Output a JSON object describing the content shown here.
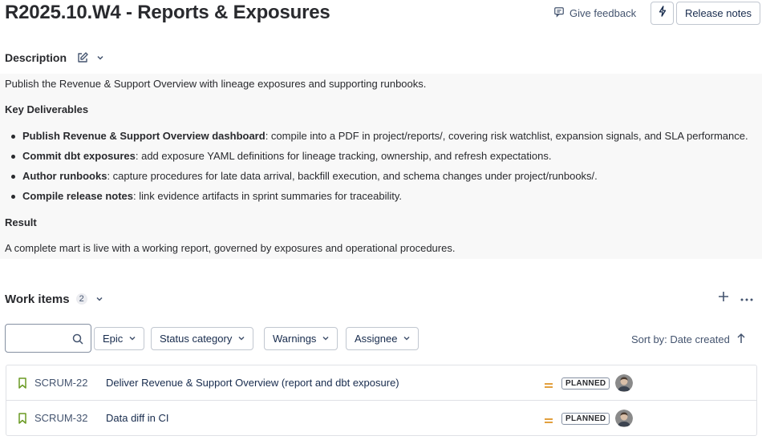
{
  "page": {
    "title": "R2025.10.W4 - Reports & Exposures",
    "feedback_label": "Give feedback",
    "release_notes_label": "Release notes"
  },
  "description": {
    "heading": "Description",
    "intro": "Publish the Revenue & Support Overview with lineage exposures and supporting runbooks.",
    "deliverables_heading": "Key Deliverables",
    "deliverables": [
      {
        "title": "Publish Revenue & Support Overview dashboard",
        "text": ": compile into a PDF in project/reports/, covering risk watchlist, expansion signals, and SLA performance."
      },
      {
        "title": "Commit dbt exposures",
        "text": ": add exposure YAML definitions for lineage tracking, ownership, and refresh expectations."
      },
      {
        "title": "Author runbooks",
        "text": ": capture procedures for late data arrival, backfill execution, and schema changes under project/runbooks/."
      },
      {
        "title": "Compile release notes",
        "text": ": link evidence artifacts in sprint summaries for traceability."
      }
    ],
    "result_heading": "Result",
    "result_text": "A complete mart is live with a working report, governed by exposures and operational procedures."
  },
  "work_items": {
    "heading": "Work items",
    "count": "2",
    "search": {
      "value": "",
      "placeholder": ""
    },
    "filters": [
      "Epic",
      "Status category",
      "Warnings",
      "Assignee"
    ],
    "sort_label": "Sort by: Date created",
    "items": [
      {
        "key": "SCRUM-22",
        "summary": "Deliver Revenue & Support Overview (report and dbt exposure)",
        "status": "PLANNED",
        "priority": "medium"
      },
      {
        "key": "SCRUM-32",
        "summary": "Data diff in CI",
        "status": "PLANNED",
        "priority": "medium"
      }
    ]
  },
  "colors": {
    "bookmark": "#6a9a23",
    "priority_medium": "#e2a03f",
    "border": "#dfe1e6",
    "description_bg": "#f8f8f8"
  },
  "icons": {
    "feedback": "feedback-icon",
    "bolt": "lightning-bolt-icon",
    "edit": "edit-icon",
    "chevron": "chevron-down-icon",
    "plus": "plus-icon",
    "more": "more-horizontal-icon",
    "search": "search-icon",
    "sort": "arrow-up-icon",
    "bookmark": "bookmark-icon",
    "priority": "priority-medium-icon"
  }
}
